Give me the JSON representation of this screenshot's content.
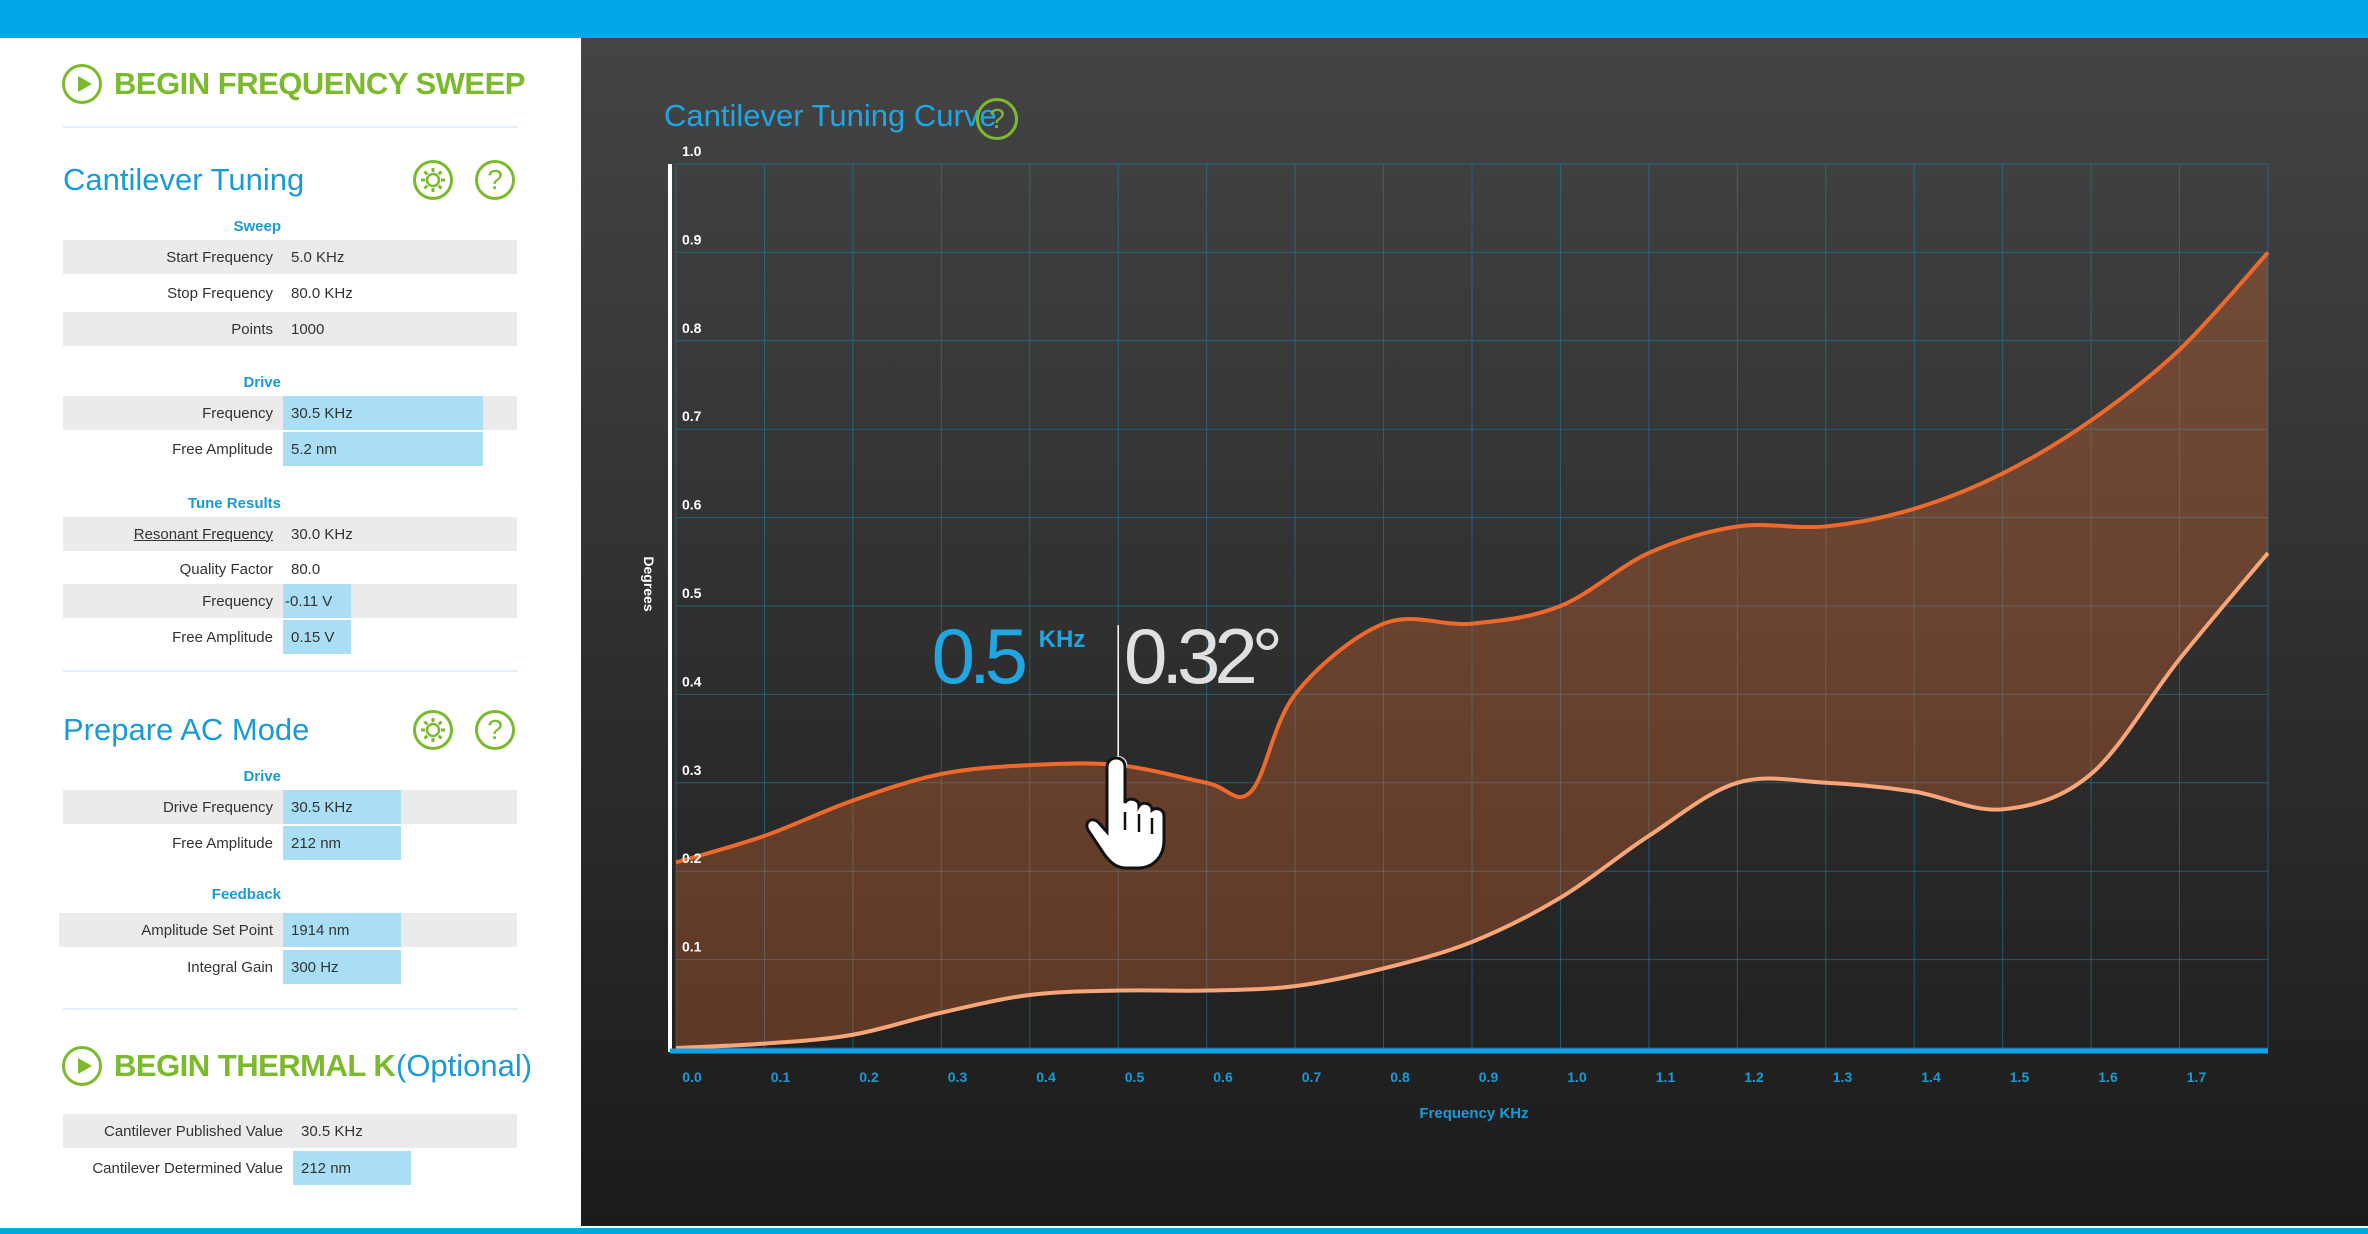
{
  "sweep_header": {
    "label": "BEGIN FREQUENCY SWEEP"
  },
  "cantilever_tuning": {
    "title": "Cantilever Tuning",
    "sweep": {
      "heading": "Sweep",
      "rows": [
        {
          "label": "Start Frequency",
          "value": "5.0 KHz"
        },
        {
          "label": "Stop Frequency",
          "value": "80.0 KHz"
        },
        {
          "label": "Points",
          "value": "1000"
        }
      ]
    },
    "drive": {
      "heading": "Drive",
      "rows": [
        {
          "label": "Frequency",
          "value": "30.5 KHz"
        },
        {
          "label": "Free Amplitude",
          "value": "5.2 nm"
        }
      ]
    },
    "tune_results": {
      "heading": "Tune Results",
      "rows": [
        {
          "label": "Resonant Frequency",
          "value": "30.0 KHz"
        },
        {
          "label": "Quality Factor",
          "value": "80.0"
        },
        {
          "label": "Frequency",
          "value": "-0.11 V"
        },
        {
          "label": "Free Amplitude",
          "value": "0.15 V"
        }
      ]
    }
  },
  "prepare_ac": {
    "title": "Prepare AC Mode",
    "drive": {
      "heading": "Drive",
      "rows": [
        {
          "label": "Drive Frequency",
          "value": "30.5 KHz"
        },
        {
          "label": "Free Amplitude",
          "value": "212 nm"
        }
      ]
    },
    "feedback": {
      "heading": "Feedback",
      "rows": [
        {
          "label": "Amplitude Set Point",
          "value": "1914 nm"
        },
        {
          "label": "Integral Gain",
          "value": "300 Hz"
        }
      ]
    }
  },
  "thermal": {
    "label": "BEGIN THERMAL K",
    "optional": "(Optional)",
    "rows": [
      {
        "label": "Cantilever Published Value",
        "value": "30.5 KHz"
      },
      {
        "label": "Cantilever Determined Value",
        "value": "212 nm"
      }
    ]
  },
  "icons": {
    "play": "play-icon",
    "settings": "gear-icon",
    "help": "help-icon",
    "cursor": "hand-pointer-icon"
  },
  "help_glyph": "?",
  "colors": {
    "accent_blue": "#00a6e6",
    "green": "#7cba2d",
    "curve_upper": "#ee6a2c",
    "curve_lower": "#f6a678"
  },
  "chart_title": "Cantilever Tuning Curve",
  "readout": {
    "freq": "0.5",
    "freq_unit": "KHz",
    "value": "0.32°"
  },
  "chart_data": {
    "type": "area",
    "title": "Cantilever Tuning Curve",
    "xlabel": "Frequency KHz",
    "ylabel": "Degrees",
    "xlim": [
      0.0,
      1.8
    ],
    "ylim": [
      0.0,
      1.0
    ],
    "x_ticks": [
      "0.0",
      "0.1",
      "0.2",
      "0.3",
      "0.4",
      "0.5",
      "0.6",
      "0.7",
      "0.8",
      "0.9",
      "1.0",
      "1.1",
      "1.2",
      "1.3",
      "1.4",
      "1.5",
      "1.6",
      "1.7"
    ],
    "y_ticks": [
      "0.1",
      "0.2",
      "0.3",
      "0.4",
      "0.5",
      "0.6",
      "0.7",
      "0.8",
      "0.9",
      "1.0"
    ],
    "grid": true,
    "series": [
      {
        "x": [
          0.0,
          0.1,
          0.2,
          0.3,
          0.4,
          0.5,
          0.6,
          0.65,
          0.7,
          0.8,
          0.9,
          1.0,
          1.1,
          1.2,
          1.3,
          1.4,
          1.5,
          1.6,
          1.7,
          1.8
        ],
        "values": [
          0.21,
          0.24,
          0.28,
          0.31,
          0.32,
          0.32,
          0.3,
          0.29,
          0.4,
          0.48,
          0.48,
          0.5,
          0.56,
          0.59,
          0.59,
          0.61,
          0.65,
          0.71,
          0.79,
          0.9
        ]
      },
      {
        "x": [
          0.0,
          0.1,
          0.2,
          0.3,
          0.4,
          0.5,
          0.6,
          0.7,
          0.8,
          0.9,
          1.0,
          1.1,
          1.2,
          1.3,
          1.4,
          1.5,
          1.6,
          1.7,
          1.8
        ],
        "values": [
          0.0,
          0.005,
          0.015,
          0.04,
          0.06,
          0.065,
          0.065,
          0.07,
          0.09,
          0.12,
          0.17,
          0.24,
          0.3,
          0.3,
          0.29,
          0.27,
          0.31,
          0.44,
          0.56
        ]
      }
    ],
    "highlight": {
      "x": 0.5,
      "y": 0.32
    }
  }
}
